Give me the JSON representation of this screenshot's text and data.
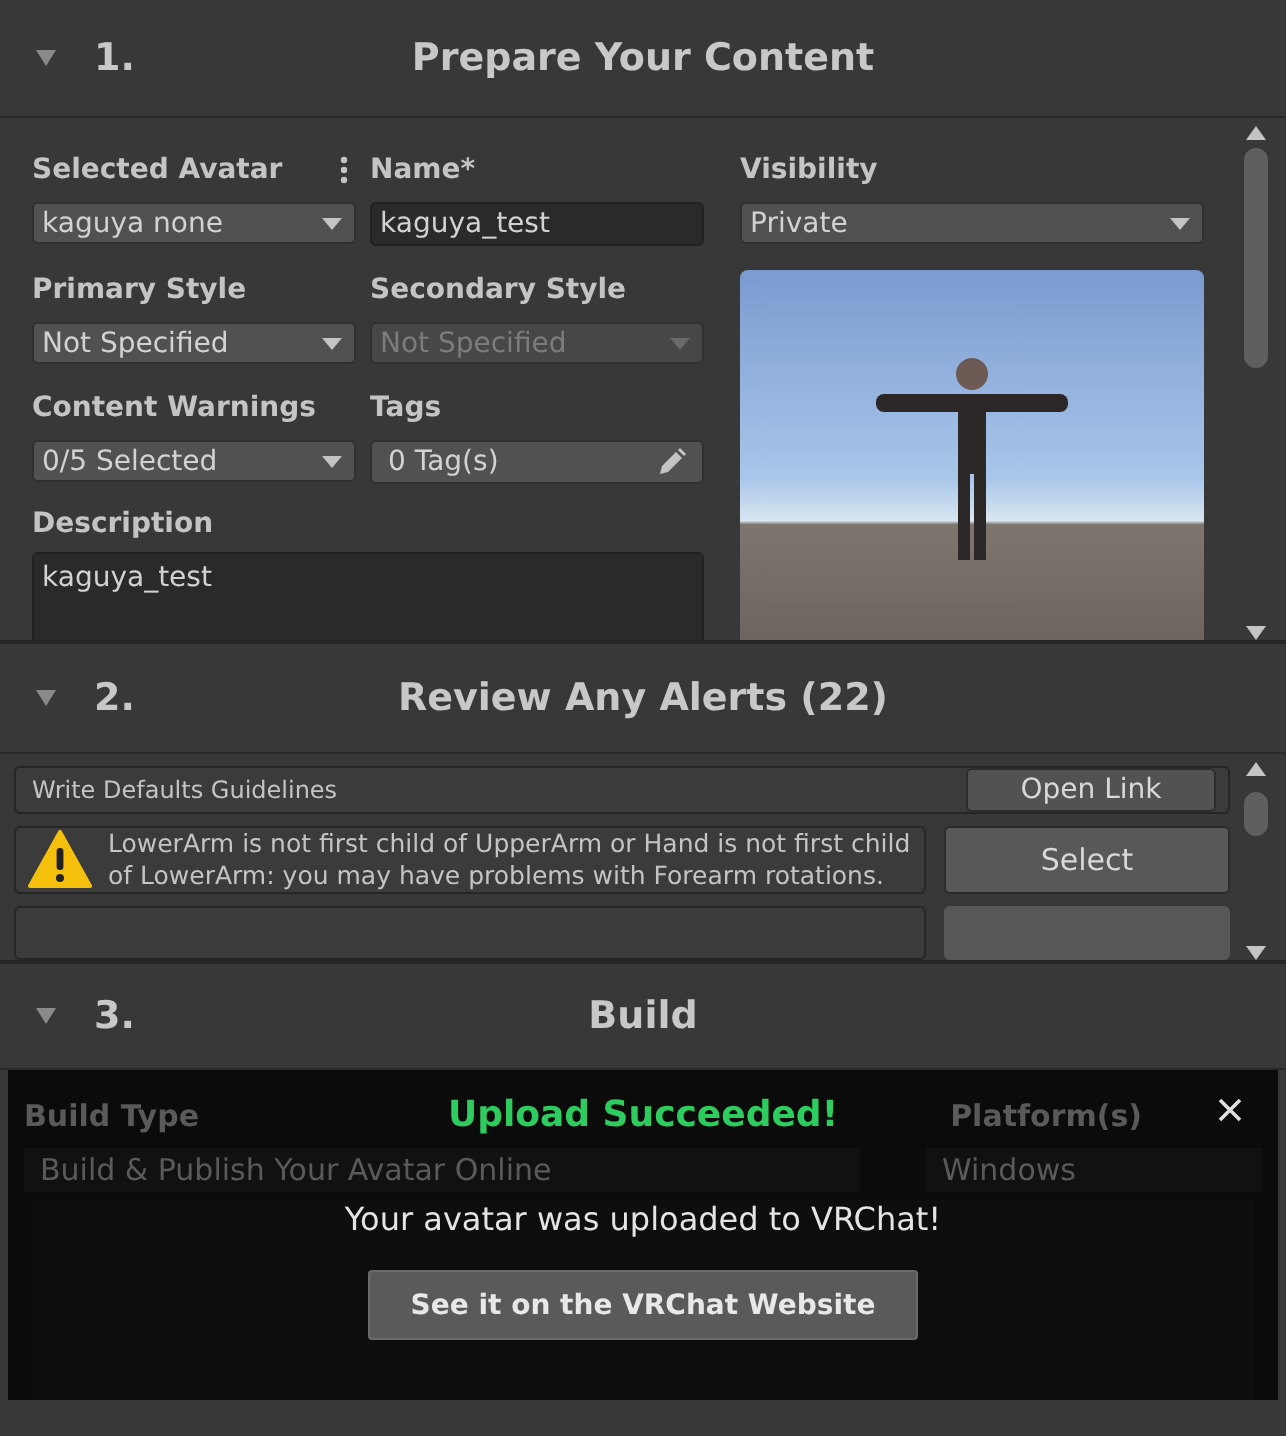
{
  "prepare": {
    "number": "1.",
    "title": "Prepare Your Content",
    "expanded": true,
    "fields": [
      {
        "kind": "dropdown",
        "label": "Selected Avatar",
        "value": "kaguya none",
        "menu": true,
        "disabled": false
      },
      {
        "kind": "text",
        "label": "Name*",
        "value": "kaguya_test"
      },
      {
        "kind": "dropdown",
        "label": "Primary Style",
        "value": "Not Specified",
        "menu": false,
        "disabled": false
      },
      {
        "kind": "dropdown",
        "label": "Secondary Style",
        "value": "Not Specified",
        "menu": false,
        "disabled": true
      },
      {
        "kind": "dropdown",
        "label": "Content Warnings",
        "value": "0/5 Selected",
        "menu": false,
        "disabled": false
      },
      {
        "kind": "tags",
        "label": "Tags",
        "value": "0 Tag(s)"
      }
    ],
    "visibility": {
      "label": "Visibility",
      "value": "Private"
    },
    "description": {
      "label": "Description",
      "value": "kaguya_test"
    }
  },
  "review": {
    "number": "2.",
    "title": "Review Any Alerts (22)",
    "expanded": true,
    "alerts": [
      {
        "kind": "info",
        "text": "Write Defaults Guidelines",
        "action": "Open Link"
      },
      {
        "kind": "warning",
        "text": "LowerArm is not first child of UpperArm or Hand is not first child of LowerArm: you may have problems with Forearm rotations.",
        "action": "Select"
      }
    ]
  },
  "build": {
    "number": "3.",
    "title": "Build",
    "expanded": true,
    "build_type": {
      "label": "Build Type",
      "value": "Build & Publish Your Avatar Online"
    },
    "platform": {
      "label": "Platform(s)",
      "value": "Windows"
    },
    "dialog": {
      "title": "Upload Succeeded!",
      "message": "Your avatar was uploaded to VRChat!",
      "button": "See it on the VRChat Website"
    }
  }
}
